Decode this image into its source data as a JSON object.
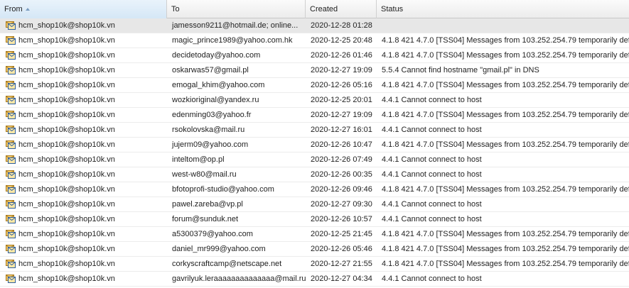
{
  "columns": {
    "from": "From",
    "to": "To",
    "created": "Created",
    "status": "Status"
  },
  "icon": "envelope-icon",
  "rows": [
    {
      "from": "hcm_shop10k@shop10k.vn",
      "to": "jamesson9211@hotmail.de; online...",
      "created": "2020-12-28 01:28",
      "status": ""
    },
    {
      "from": "hcm_shop10k@shop10k.vn",
      "to": "magic_prince1989@yahoo.com.hk",
      "created": "2020-12-25 20:48",
      "status": "4.1.8 421 4.7.0 [TSS04] Messages from 103.252.254.79 temporarily def"
    },
    {
      "from": "hcm_shop10k@shop10k.vn",
      "to": "decidetoday@yahoo.com",
      "created": "2020-12-26 01:46",
      "status": "4.1.8 421 4.7.0 [TSS04] Messages from 103.252.254.79 temporarily def"
    },
    {
      "from": "hcm_shop10k@shop10k.vn",
      "to": "oskarwas57@gmail.pl",
      "created": "2020-12-27 19:09",
      "status": "5.5.4 Cannot find hostname \"gmail.pl\" in DNS"
    },
    {
      "from": "hcm_shop10k@shop10k.vn",
      "to": "emogal_khim@yahoo.com",
      "created": "2020-12-26 05:16",
      "status": "4.1.8 421 4.7.0 [TSS04] Messages from 103.252.254.79 temporarily def"
    },
    {
      "from": "hcm_shop10k@shop10k.vn",
      "to": "wozkioriginal@yandex.ru",
      "created": "2020-12-25 20:01",
      "status": "4.4.1 Cannot connect to host"
    },
    {
      "from": "hcm_shop10k@shop10k.vn",
      "to": "edenming03@yahoo.fr",
      "created": "2020-12-27 19:09",
      "status": "4.1.8 421 4.7.0 [TSS04] Messages from 103.252.254.79 temporarily def"
    },
    {
      "from": "hcm_shop10k@shop10k.vn",
      "to": "rsokolovska@mail.ru",
      "created": "2020-12-27 16:01",
      "status": "4.4.1 Cannot connect to host"
    },
    {
      "from": "hcm_shop10k@shop10k.vn",
      "to": "jujerm09@yahoo.com",
      "created": "2020-12-26 10:47",
      "status": "4.1.8 421 4.7.0 [TSS04] Messages from 103.252.254.79 temporarily def"
    },
    {
      "from": "hcm_shop10k@shop10k.vn",
      "to": "inteltom@op.pl",
      "created": "2020-12-26 07:49",
      "status": "4.4.1 Cannot connect to host"
    },
    {
      "from": "hcm_shop10k@shop10k.vn",
      "to": "west-w80@mail.ru",
      "created": "2020-12-26 00:35",
      "status": "4.4.1 Cannot connect to host"
    },
    {
      "from": "hcm_shop10k@shop10k.vn",
      "to": "bfotoprofi-studio@yahoo.com",
      "created": "2020-12-26 09:46",
      "status": "4.1.8 421 4.7.0 [TSS04] Messages from 103.252.254.79 temporarily def"
    },
    {
      "from": "hcm_shop10k@shop10k.vn",
      "to": "pawel.zareba@vp.pl",
      "created": "2020-12-27 09:30",
      "status": "4.4.1 Cannot connect to host"
    },
    {
      "from": "hcm_shop10k@shop10k.vn",
      "to": "forum@sunduk.net",
      "created": "2020-12-26 10:57",
      "status": "4.4.1 Cannot connect to host"
    },
    {
      "from": "hcm_shop10k@shop10k.vn",
      "to": "a5300379@yahoo.com",
      "created": "2020-12-25 21:45",
      "status": "4.1.8 421 4.7.0 [TSS04] Messages from 103.252.254.79 temporarily def"
    },
    {
      "from": "hcm_shop10k@shop10k.vn",
      "to": "daniel_mr999@yahoo.com",
      "created": "2020-12-26 05:46",
      "status": "4.1.8 421 4.7.0 [TSS04] Messages from 103.252.254.79 temporarily def"
    },
    {
      "from": "hcm_shop10k@shop10k.vn",
      "to": "corkyscraftcamp@netscape.net",
      "created": "2020-12-27 21:55",
      "status": "4.1.8 421 4.7.0 [TSS04] Messages from 103.252.254.79 temporarily def"
    },
    {
      "from": "hcm_shop10k@shop10k.vn",
      "to": "gavrilyuk.leraaaaaaaaaaaaaa@mail.ru",
      "created": "2020-12-27 04:34",
      "status": "4.4.1 Cannot connect to host"
    }
  ]
}
